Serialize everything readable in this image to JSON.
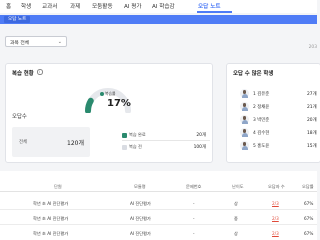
{
  "nav": {
    "items": [
      {
        "label": "홈"
      },
      {
        "label": "학생"
      },
      {
        "label": "교과서"
      },
      {
        "label": "과제"
      },
      {
        "label": "모둠활동"
      },
      {
        "label": "AI 평가"
      },
      {
        "label": "AI 학습감"
      },
      {
        "label": "오답 노트"
      }
    ],
    "active_index": 7,
    "accent_color": "#4f7cf6"
  },
  "banner": {
    "title": "오답 노트"
  },
  "class_select": {
    "value": "과목 전체"
  },
  "corner_number": "203",
  "review": {
    "title": "복습 현황",
    "info_icon": "info-icon",
    "gauge": {
      "label": "복습률",
      "percent": 17,
      "percent_text": "17%",
      "fill_color": "#2a8a6e"
    },
    "subtitle": "오답수",
    "total": {
      "label": "전체",
      "value": "120개"
    },
    "legend": [
      {
        "label": "복습 완료",
        "value": "20개",
        "color": "#2a8a6e"
      },
      {
        "label": "복습 전",
        "value": "100개",
        "color": "#d9dce2"
      }
    ]
  },
  "wrong_students": {
    "title": "오답 수 많은 학생",
    "items": [
      {
        "name": "1 김유준",
        "count": "27개"
      },
      {
        "name": "2 정채윤",
        "count": "21개"
      },
      {
        "name": "3 박민준",
        "count": "20개"
      },
      {
        "name": "4 김수현",
        "count": "18개"
      },
      {
        "name": "5 홍도윤",
        "count": "15개"
      }
    ]
  },
  "table": {
    "headers": [
      "단원",
      "모듈명",
      "문제번호",
      "난이도",
      "오답자 수",
      "오답률"
    ],
    "rows": [
      {
        "unit": "학년 초 AI 진단평가",
        "module": "AI 진단평가",
        "qno": "-",
        "level": "상",
        "wrong": "2/3",
        "rate": "67%"
      },
      {
        "unit": "학년 초 AI 진단평가",
        "module": "AI 진단평가",
        "qno": "-",
        "level": "중",
        "wrong": "2/3",
        "rate": "67%"
      },
      {
        "unit": "학년 초 AI 진단평가",
        "module": "AI 진단평가",
        "qno": "-",
        "level": "상",
        "wrong": "2/3",
        "rate": "67%"
      }
    ]
  }
}
